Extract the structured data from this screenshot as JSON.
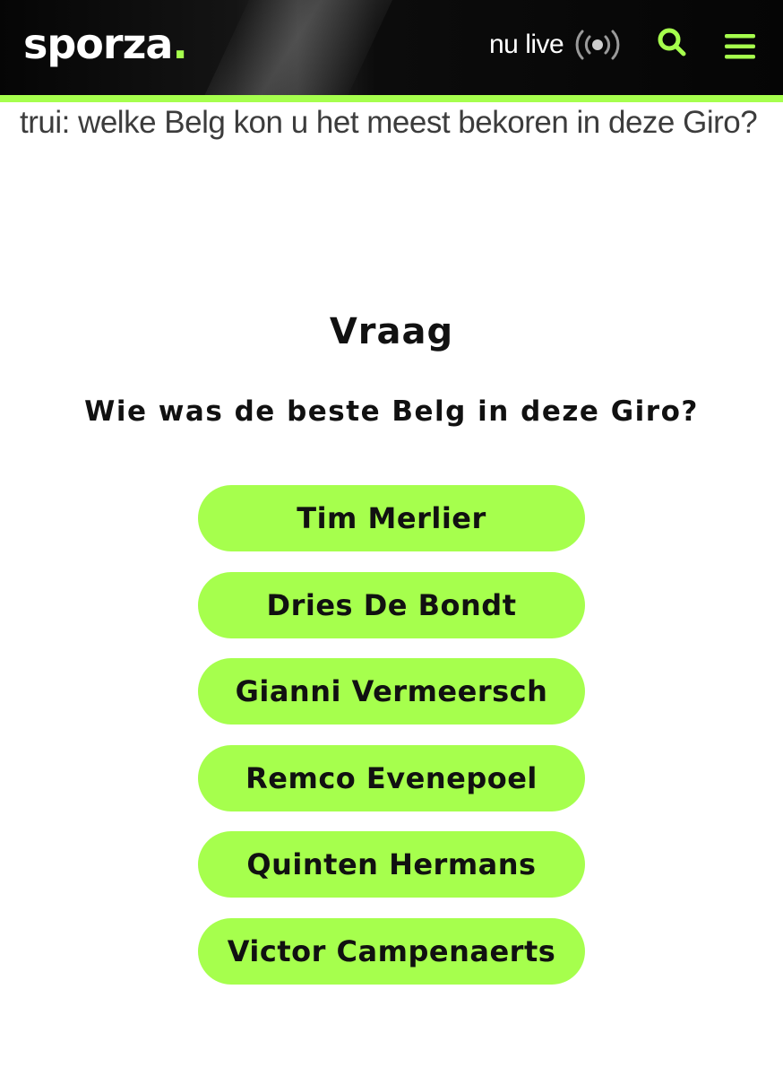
{
  "header": {
    "logo_text": "sporza",
    "logo_dot": ".",
    "live_label": "nu live",
    "live_icon": "broadcast-icon",
    "search_icon": "search-icon",
    "menu_icon": "hamburger-menu-icon",
    "accent_color": "#a6ff4d",
    "background_color": "#050505"
  },
  "article": {
    "text": "trui: welke Belg kon u het meest bekoren in deze Giro?"
  },
  "quiz": {
    "title": "Vraag",
    "question": "Wie was de beste Belg in deze Giro?",
    "option_color": "#a6ff4d",
    "options": [
      {
        "label": "Tim Merlier"
      },
      {
        "label": "Dries De Bondt"
      },
      {
        "label": "Gianni Vermeersch"
      },
      {
        "label": "Remco Evenepoel"
      },
      {
        "label": "Quinten Hermans"
      },
      {
        "label": "Victor Campenaerts"
      }
    ]
  }
}
